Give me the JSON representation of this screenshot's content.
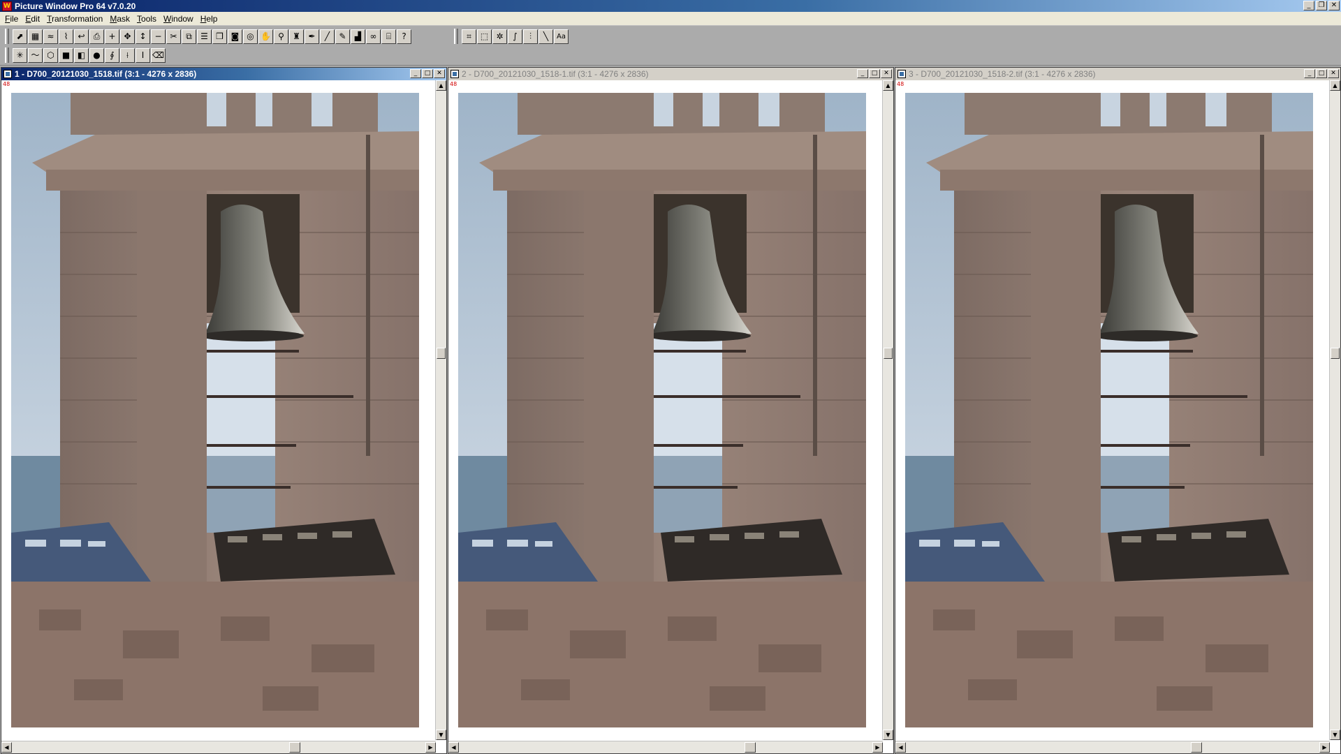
{
  "app": {
    "title": "Picture Window Pro 64  v7.0.20",
    "icon_letter": "W",
    "controls": [
      "minimize",
      "restore",
      "close"
    ]
  },
  "menu": [
    "File",
    "Edit",
    "Transformation",
    "Mask",
    "Tools",
    "Window",
    "Help"
  ],
  "toolbar_row1": {
    "group1": [
      "open-icon",
      "grid-icon",
      "wave-icon",
      "brush-icon",
      "undo-icon",
      "print-icon",
      "plus-icon",
      "move-icon",
      "resize-icon",
      "minus-icon",
      "crop-icon",
      "copy-icon",
      "list-icon",
      "layers-icon",
      "camera-icon",
      "dial-icon",
      "hand-icon",
      "zoom-icon",
      "stamp-icon",
      "pen-icon",
      "line-icon",
      "pencil-icon",
      "histogram-icon",
      "link-icon",
      "capture-icon",
      "help-icon"
    ],
    "group2": [
      "crop-frame-icon",
      "select-icon",
      "sparkle-icon",
      "curve-icon",
      "levels-icon",
      "line-tool-icon",
      "text-icon"
    ],
    "text_tool_label": "Aa",
    "help_label": "?"
  },
  "toolbar_row2": [
    "sharpen-icon",
    "curve-icon",
    "selection-icon",
    "fill-black-icon",
    "gradient-icon",
    "circle-icon",
    "curve2-icon",
    "measure-icon",
    "cursor-icon",
    "eraser-icon"
  ],
  "windows": [
    {
      "title": "1 - D700_20121030_1518.tif (3:1 - 4276 x 2836)",
      "active": true,
      "zoom_marker": "48"
    },
    {
      "title": "2 - D700_20121030_1518-1.tif (3:1 - 4276 x 2836)",
      "active": false,
      "zoom_marker": "48"
    },
    {
      "title": "3 - D700_20121030_1518-2.tif (3:1 - 4276 x 2836)",
      "active": false,
      "zoom_marker": "48"
    }
  ],
  "colors": {
    "active_title_start": "#0a246a",
    "active_title_end": "#a6caf0",
    "inactive_title": "#d4d0c8",
    "workspace": "#ababab",
    "zoom_marker": "#d00000"
  }
}
